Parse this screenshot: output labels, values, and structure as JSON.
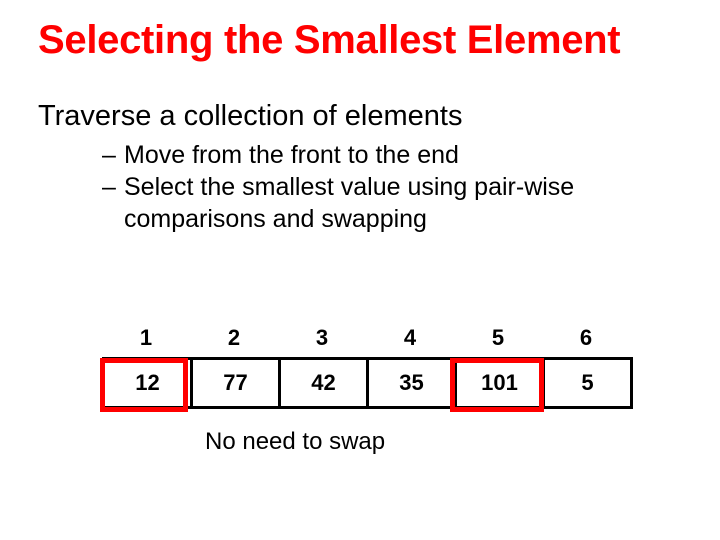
{
  "title": "Selecting the Smallest Element",
  "lead": "Traverse a collection of elements",
  "bullets": [
    "Move from the front to the end",
    "Select the smallest value using pair-wise comparisons and swapping"
  ],
  "array": {
    "indices": [
      "1",
      "2",
      "3",
      "4",
      "5",
      "6"
    ],
    "values": [
      "12",
      "77",
      "42",
      "35",
      "101",
      "5"
    ],
    "highlight_positions": [
      0,
      4
    ]
  },
  "caption": "No need to swap"
}
